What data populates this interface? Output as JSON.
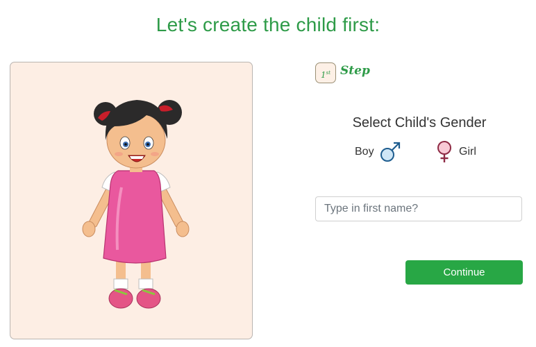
{
  "page": {
    "title": "Let's create the child first:"
  },
  "step": {
    "badge_number": "1",
    "badge_suffix": "st",
    "label": "Step"
  },
  "gender": {
    "heading": "Select Child's Gender",
    "options": [
      {
        "label": "Boy",
        "icon": "male-symbol-icon",
        "color": "#3b8fd6"
      },
      {
        "label": "Girl",
        "icon": "female-symbol-icon",
        "color": "#e0708a"
      }
    ]
  },
  "name_input": {
    "placeholder": "Type in first name?",
    "value": ""
  },
  "actions": {
    "continue_label": "Continue"
  },
  "colors": {
    "accent": "#2e9b48",
    "button": "#28a745",
    "card_background": "#fdeee4"
  }
}
